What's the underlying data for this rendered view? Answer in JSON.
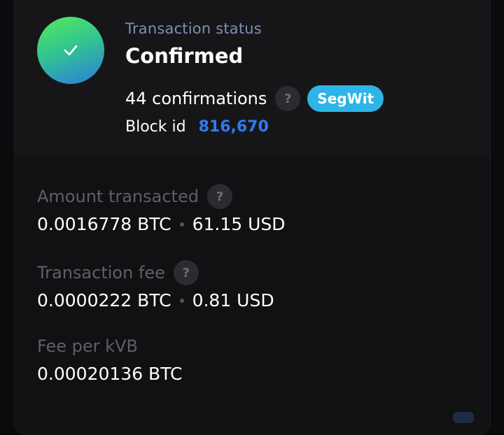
{
  "status": {
    "label": "Transaction status",
    "value": "Confirmed",
    "icon": "check-icon",
    "colors": {
      "gradient_start": "#55ea5c",
      "gradient_end": "#2a7ddc"
    }
  },
  "confirmations": {
    "text": "44 confirmations",
    "help": "?",
    "badge": "SegWit",
    "badge_color": "#2fb4e8"
  },
  "block": {
    "label": "Block id",
    "value": "816,670",
    "value_color": "#2d7cf0"
  },
  "details": {
    "amount": {
      "label": "Amount transacted",
      "help": "?",
      "btc": "0.0016778 BTC",
      "usd": "61.15 USD"
    },
    "fee": {
      "label": "Transaction fee",
      "help": "?",
      "btc": "0.0000222 BTC",
      "usd": "0.81 USD"
    },
    "fee_per_kvb": {
      "label": "Fee per kVB",
      "btc": "0.00020136 BTC"
    }
  }
}
